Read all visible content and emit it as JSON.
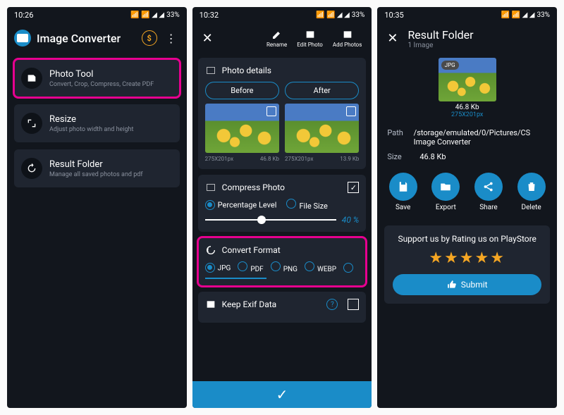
{
  "status": {
    "time1": "10:26",
    "time2": "10:32",
    "time3": "10:35",
    "battery": "33%"
  },
  "screen1": {
    "title": "Image Converter",
    "items": [
      {
        "title": "Photo Tool",
        "sub": "Convert, Crop, Compress, Create PDF"
      },
      {
        "title": "Resize",
        "sub": "Adjust photo width and height"
      },
      {
        "title": "Result Folder",
        "sub": "Manage all saved photos and pdf"
      }
    ]
  },
  "screen2": {
    "actions": {
      "rename": "Rename",
      "edit": "Edit Photo",
      "add": "Add Photos"
    },
    "details": {
      "title": "Photo details",
      "before": "Before",
      "after": "After",
      "dim": "275X201px",
      "size1": "46.8 Kb",
      "size2": "13.9 Kb"
    },
    "compress": {
      "title": "Compress Photo",
      "opt1": "Percentage Level",
      "opt2": "File Size",
      "pct": "40 %"
    },
    "convert": {
      "title": "Convert Format",
      "formats": [
        "JPG",
        "PDF",
        "PNG",
        "WEBP"
      ]
    },
    "exif": {
      "title": "Keep Exif Data"
    }
  },
  "screen3": {
    "title": "Result Folder",
    "sub": "1 Image",
    "badge": "JPG",
    "size": "46.8 Kb",
    "dim": "275X201px",
    "path_label": "Path",
    "path": "/storage/emulated/0/Pictures/CS Image Converter",
    "size_label": "Size",
    "size_val": "46.8 Kb",
    "actions": {
      "save": "Save",
      "export": "Export",
      "share": "Share",
      "delete": "Delete"
    },
    "rate": "Support us by Rating us on PlayStore",
    "submit": "Submit"
  }
}
